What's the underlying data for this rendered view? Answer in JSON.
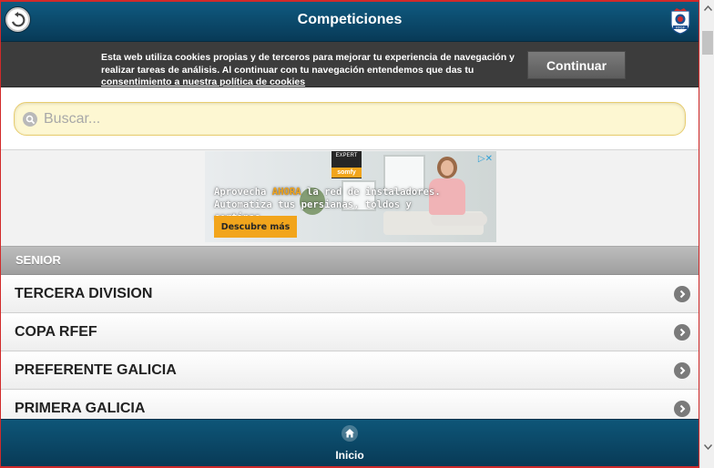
{
  "header": {
    "title": "Competiciones",
    "back_icon": "back-arrow-icon",
    "logo_text": "RFGF"
  },
  "cookie_banner": {
    "text": "Esta web utiliza cookies propias y de terceros para mejorar tu experiencia de navegación y realizar tareas de análisis. Al continuar con tu navegación entendemos que das tu",
    "link_text": "consentimiento a nuestra política de cookies",
    "button_label": "Continuar"
  },
  "search": {
    "placeholder": "Buscar...",
    "value": ""
  },
  "ad": {
    "brand_top": "EXPERT",
    "brand": "somfy",
    "adchoices": "▷✕",
    "headline_pre": "Aprovecha ",
    "headline_highlight": "AHORA",
    "headline_post": " la red de instaladores.",
    "headline_line2": "Automatiza tus persianas, toldos y cortinas.",
    "cta": "Descubre más"
  },
  "section": {
    "title": "SENIOR"
  },
  "competitions": [
    {
      "label": "TERCERA DIVISION"
    },
    {
      "label": "COPA RFEF"
    },
    {
      "label": "PREFERENTE GALICIA"
    },
    {
      "label": "PRIMERA GALICIA"
    }
  ],
  "footer": {
    "home_label": "Inicio",
    "home_icon": "home-icon"
  },
  "colors": {
    "header_bg": "#0b4a6b",
    "accent": "#f2a51c",
    "search_bg": "#fdf7d2",
    "frame_border": "#d12a2a"
  }
}
